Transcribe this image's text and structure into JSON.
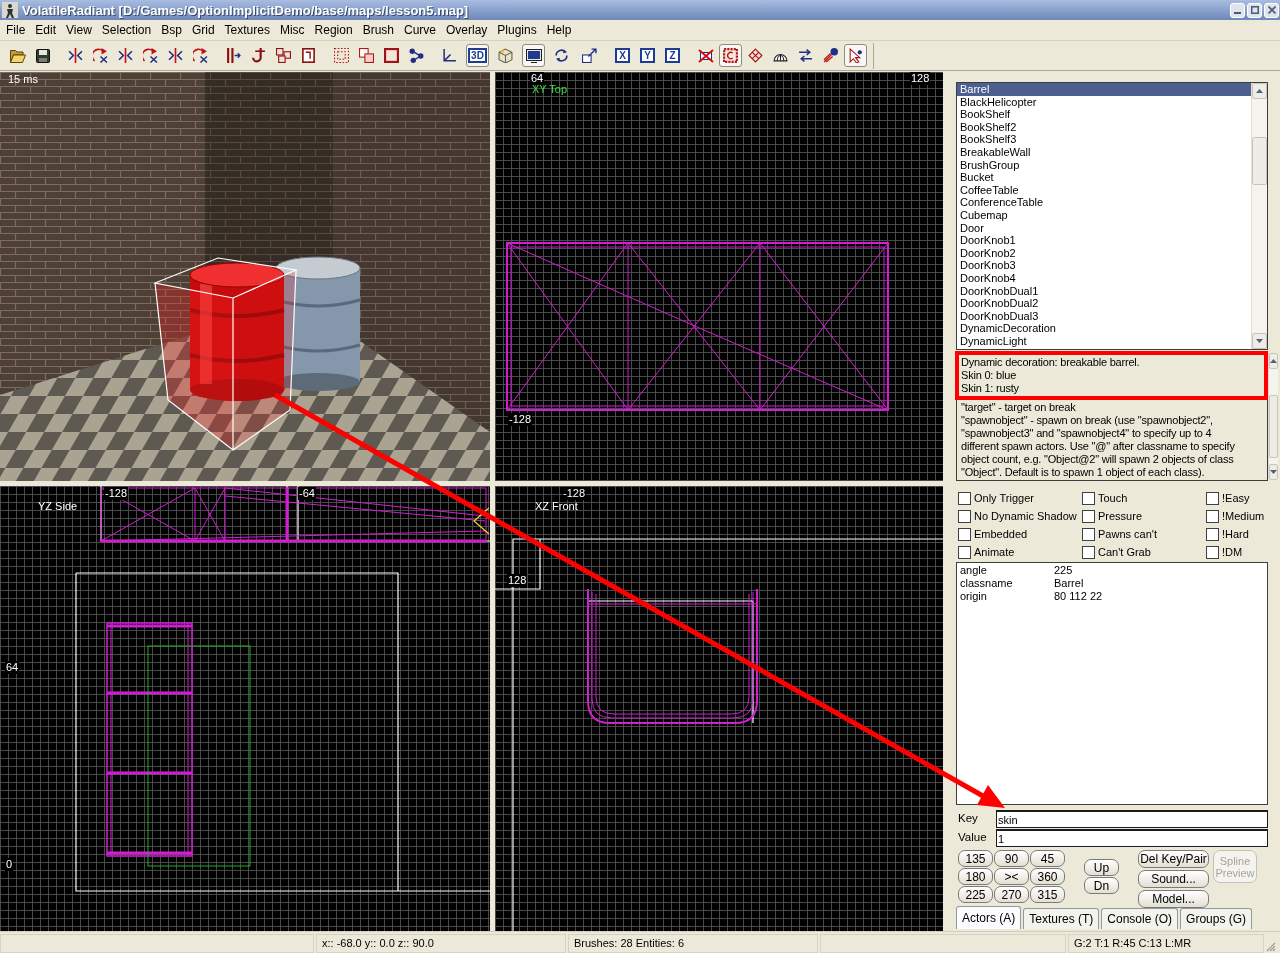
{
  "window": {
    "title": "VolatileRadiant [D:/Games/OptionImplicitDemo/base/maps/lesson5.map]"
  },
  "menu": [
    "File",
    "Edit",
    "View",
    "Selection",
    "Bsp",
    "Grid",
    "Textures",
    "Misc",
    "Region",
    "Brush",
    "Curve",
    "Overlay",
    "Plugins",
    "Help"
  ],
  "toolbar": [
    [
      {
        "pressed": false
      },
      {
        "pressed": false
      }
    ],
    [
      {
        "pressed": false
      },
      {
        "pressed": false
      },
      {
        "pressed": false
      },
      {
        "pressed": false
      },
      {
        "pressed": false
      },
      {
        "pressed": false
      }
    ],
    [
      {
        "pressed": false
      },
      {
        "pressed": false
      },
      {
        "pressed": false
      },
      {
        "pressed": false
      }
    ],
    [
      {
        "pressed": false
      },
      {
        "pressed": false
      },
      {
        "pressed": false
      },
      {
        "pressed": false
      }
    ],
    [
      {
        "pressed": false
      },
      {
        "label": "3D",
        "pressed": true
      },
      {
        "pressed": false
      },
      {
        "pressed": true
      },
      {
        "pressed": false
      },
      {
        "pressed": false
      }
    ],
    [
      {
        "label": "X",
        "pressed": false
      },
      {
        "label": "Y",
        "pressed": false
      },
      {
        "label": "Z",
        "pressed": false
      }
    ],
    [
      {
        "pressed": false
      },
      {
        "pressed": true
      },
      {
        "pressed": false
      },
      {
        "pressed": false
      },
      {
        "pressed": false
      },
      {
        "pressed": false
      },
      {
        "pressed": true
      }
    ]
  ],
  "viewports": [
    {
      "kind": "camera",
      "timing": "15 ms"
    },
    {
      "kind": "grid",
      "title": "XY Top",
      "active": true,
      "ruler_labels": [
        "64",
        "128",
        "-128"
      ]
    },
    {
      "kind": "grid",
      "title": "YZ Side",
      "active": false,
      "ruler_labels": [
        "-128",
        "-64",
        "64",
        "0"
      ]
    },
    {
      "kind": "grid",
      "title": "XZ Front",
      "active": false,
      "ruler_labels": [
        "-128",
        "128"
      ]
    }
  ],
  "entity_list": {
    "items": [
      {
        "label": "Barrel",
        "selected": true
      },
      {
        "label": "BlackHelicopter",
        "selected": false
      },
      {
        "label": "BookShelf",
        "selected": false
      },
      {
        "label": "BookShelf2",
        "selected": false
      },
      {
        "label": "BookShelf3",
        "selected": false
      },
      {
        "label": "BreakableWall",
        "selected": false
      },
      {
        "label": "BrushGroup",
        "selected": false
      },
      {
        "label": "Bucket",
        "selected": false
      },
      {
        "label": "CoffeeTable",
        "selected": false
      },
      {
        "label": "ConferenceTable",
        "selected": false
      },
      {
        "label": "Cubemap",
        "selected": false
      },
      {
        "label": "Door",
        "selected": false
      },
      {
        "label": "DoorKnob1",
        "selected": false
      },
      {
        "label": "DoorKnob2",
        "selected": false
      },
      {
        "label": "DoorKnob3",
        "selected": false
      },
      {
        "label": "DoorKnob4",
        "selected": false
      },
      {
        "label": "DoorKnobDual1",
        "selected": false
      },
      {
        "label": "DoorKnobDual2",
        "selected": false
      },
      {
        "label": "DoorKnobDual3",
        "selected": false
      },
      {
        "label": "DynamicDecoration",
        "selected": false
      },
      {
        "label": "DynamicLight",
        "selected": false
      }
    ]
  },
  "description": [
    {
      "text": "Dynamic decoration: breakable barrel.\nSkin 0: blue\nSkin 1: rusty",
      "highlighted": true
    },
    {
      "text": "\"target\" - target on break\n\"spawnobject\" - spawn on break (use \"spawnobject2\",\n\"spawnobject3\" and \"spawnobject4\" to specify up to 4\ndifferent spawn actors. Use \"@\" after classname to specify\nobject count, e.g. \"Object@2\" will spawn 2 objects of class\n\"Object\". Default is to spawn 1 object of each class).",
      "highlighted": false
    }
  ],
  "flags": [
    {
      "label": "Only Trigger",
      "checked": false
    },
    {
      "label": "Touch",
      "checked": false
    },
    {
      "label": "!Easy",
      "checked": false
    },
    {
      "label": "No Dynamic Shadow",
      "checked": false
    },
    {
      "label": "Pressure",
      "checked": false
    },
    {
      "label": "!Medium",
      "checked": false
    },
    {
      "label": "Embedded",
      "checked": false
    },
    {
      "label": "Pawns can't",
      "checked": false
    },
    {
      "label": "!Hard",
      "checked": false
    },
    {
      "label": "Animate",
      "checked": false
    },
    {
      "label": "Can't Grab",
      "checked": false
    },
    {
      "label": "!DM",
      "checked": false
    }
  ],
  "properties": [
    {
      "key": "angle",
      "value": "225"
    },
    {
      "key": "classname",
      "value": "Barrel"
    },
    {
      "key": "origin",
      "value": "80 112 22"
    }
  ],
  "key_field": {
    "label": "Key",
    "value": "skin"
  },
  "value_field": {
    "label": "Value",
    "value": "1"
  },
  "angle_buttons": [
    "135",
    "90",
    "45",
    "180",
    "><",
    "360",
    "225",
    "270",
    "315"
  ],
  "order_buttons": [
    "Up",
    "Dn"
  ],
  "action_buttons": [
    "Del Key/Pair",
    "Sound...",
    "Model..."
  ],
  "spline_button": {
    "label": "Spline Preview",
    "disabled": true
  },
  "tabs": [
    {
      "label": "Actors (A)",
      "selected": true
    },
    {
      "label": "Textures (T)",
      "selected": false
    },
    {
      "label": "Console (O)",
      "selected": false
    },
    {
      "label": "Groups (G)",
      "selected": false
    }
  ],
  "status_bar": {
    "coordinates": "x:: -68.0 y:: 0.0 z:: 90.0",
    "counts": "Brushes: 28 Entities: 6",
    "grid": "G:2 T:1 R:45 C:13 L:MR"
  }
}
